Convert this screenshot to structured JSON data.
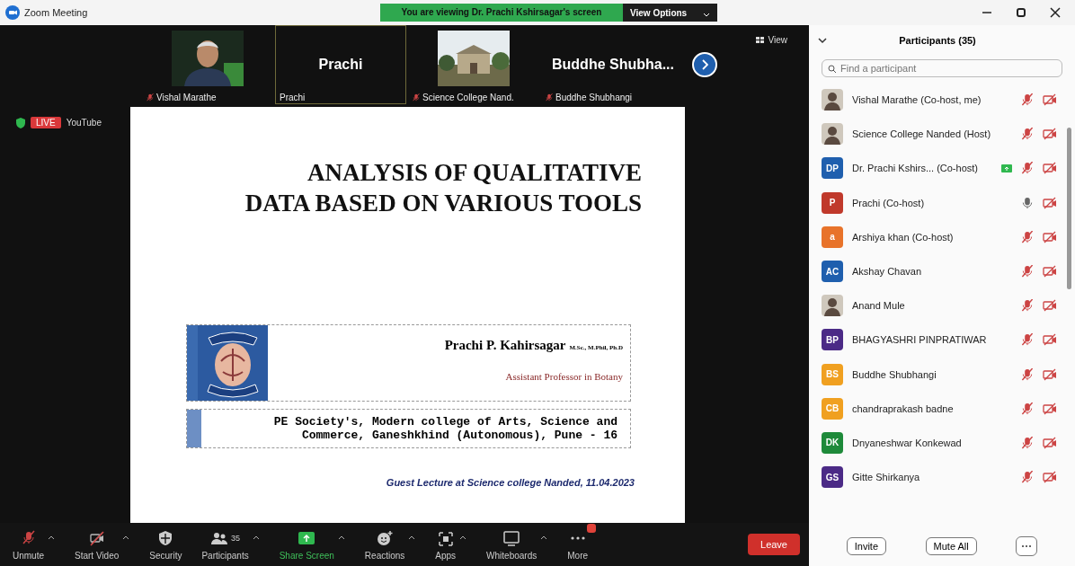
{
  "window": {
    "title": "Zoom Meeting"
  },
  "share_banner": {
    "text": "You are viewing Dr. Prachi Kshirsagar's screen",
    "view_options": "View Options"
  },
  "video_strip": {
    "tiles": [
      {
        "kind": "video",
        "label": "Vishal Marathe",
        "muted": true,
        "selected": false
      },
      {
        "kind": "name",
        "name": "Prachi",
        "label": "Prachi",
        "muted": false,
        "selected": true
      },
      {
        "kind": "video",
        "label": "Science College Nand.",
        "muted": true,
        "selected": false
      },
      {
        "kind": "name",
        "name": "Buddhe Shubha...",
        "label": "Buddhe Shubhangi",
        "muted": true,
        "selected": false
      }
    ],
    "view_label": "View"
  },
  "live": {
    "badge": "LIVE",
    "service": "YouTube"
  },
  "slide": {
    "title_lines": [
      "ANALYSIS OF QUALITATIVE",
      "DATA BASED ON VARIOUS TOOLS"
    ],
    "presenter": "Prachi P. Kahirsagar",
    "degrees": "M.Sc., M.Phil, Ph.D",
    "position": "Assistant Professor in Botany",
    "institution_lines": [
      "PE Society's, Modern college of Arts, Science and",
      "Commerce, Ganeshkhind (Autonomous), Pune - 16"
    ],
    "footer": "Guest Lecture at Science college Nanded, 11.04.2023"
  },
  "toolbar": {
    "buttons": [
      {
        "kind": "mic-off",
        "label": "Unmute",
        "caret": true
      },
      {
        "kind": "video-off",
        "label": "Start Video",
        "caret": true
      },
      {
        "kind": "security",
        "label": "Security",
        "caret": false
      },
      {
        "kind": "participants",
        "label": "Participants",
        "count": "35",
        "caret": true
      },
      {
        "kind": "share",
        "label": "Share Screen",
        "caret": true
      },
      {
        "kind": "reactions",
        "label": "Reactions",
        "caret": true
      },
      {
        "kind": "apps",
        "label": "Apps",
        "caret": true
      },
      {
        "kind": "whiteboard",
        "label": "Whiteboards",
        "caret": true
      },
      {
        "kind": "more",
        "label": "More",
        "caret": false
      }
    ],
    "leave": "Leave"
  },
  "participants_panel": {
    "title": "Participants (35)",
    "search_placeholder": "Find a participant",
    "items": [
      {
        "name": "Vishal Marathe (Co-host, me)",
        "mic_muted": true,
        "sharing": false
      },
      {
        "name": "Science College Nanded (Host)",
        "mic_muted": true,
        "sharing": false
      },
      {
        "name": "Dr. Prachi Kshirs... (Co-host)",
        "kind": "initials",
        "initials": "DP",
        "color": "#1f5fae",
        "mic_muted": true,
        "sharing": true
      },
      {
        "name": "Prachi (Co-host)",
        "kind": "initials",
        "initials": "P",
        "color": "#c0392b",
        "mic_muted": false,
        "sharing": false
      },
      {
        "name": "Arshiya khan (Co-host)",
        "kind": "initials",
        "initials": "a",
        "color": "#e8732a",
        "mic_muted": true,
        "sharing": false
      },
      {
        "name": "Akshay Chavan",
        "kind": "initials",
        "initials": "AC",
        "color": "#1f5fae",
        "mic_muted": true,
        "sharing": false
      },
      {
        "name": "Anand Mule",
        "mic_muted": true,
        "sharing": false
      },
      {
        "name": "BHAGYASHRI PINPRATIWAR",
        "kind": "initials",
        "initials": "BP",
        "color": "#4b2a86",
        "mic_muted": true,
        "sharing": false
      },
      {
        "name": "Buddhe Shubhangi",
        "kind": "initials",
        "initials": "BS",
        "color": "#f0a020",
        "mic_muted": true,
        "sharing": false
      },
      {
        "name": "chandraprakash badne",
        "kind": "initials",
        "initials": "CB",
        "color": "#f0a020",
        "mic_muted": true,
        "sharing": false
      },
      {
        "name": "Dnyaneshwar Konkewad",
        "kind": "initials",
        "initials": "DK",
        "color": "#1e8a3a",
        "mic_muted": true,
        "sharing": false
      },
      {
        "name": "Gitte Shirkanya",
        "kind": "initials",
        "initials": "GS",
        "color": "#4b2a86",
        "mic_muted": true,
        "sharing": false
      }
    ],
    "buttons": [
      "Invite",
      "Mute All"
    ]
  }
}
